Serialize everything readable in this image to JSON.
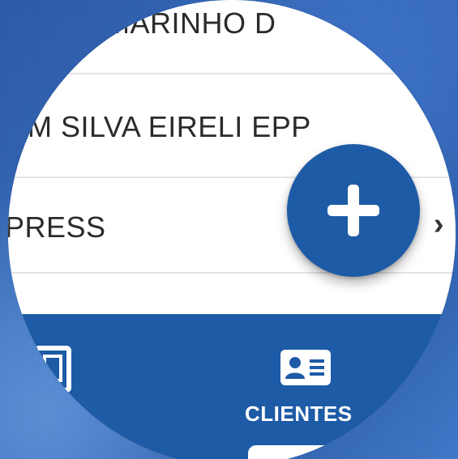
{
  "list": {
    "rows": [
      {
        "text": "MARINHO D"
      },
      {
        "text": "M SILVA EIRELI EPP",
        "chevron": "›"
      },
      {
        "text": "PRESS",
        "chevron": "›"
      }
    ]
  },
  "fab": {
    "icon": "plus-icon"
  },
  "bottom_nav": {
    "items": [
      {
        "icon": "document-icon",
        "label": ""
      },
      {
        "icon": "contact-card-icon",
        "label": "CLIENTES"
      }
    ]
  },
  "colors": {
    "primary": "#1e5ba6",
    "background": "#3569b7",
    "row_divider": "#e4e4e4",
    "text": "#2b2b2b"
  }
}
